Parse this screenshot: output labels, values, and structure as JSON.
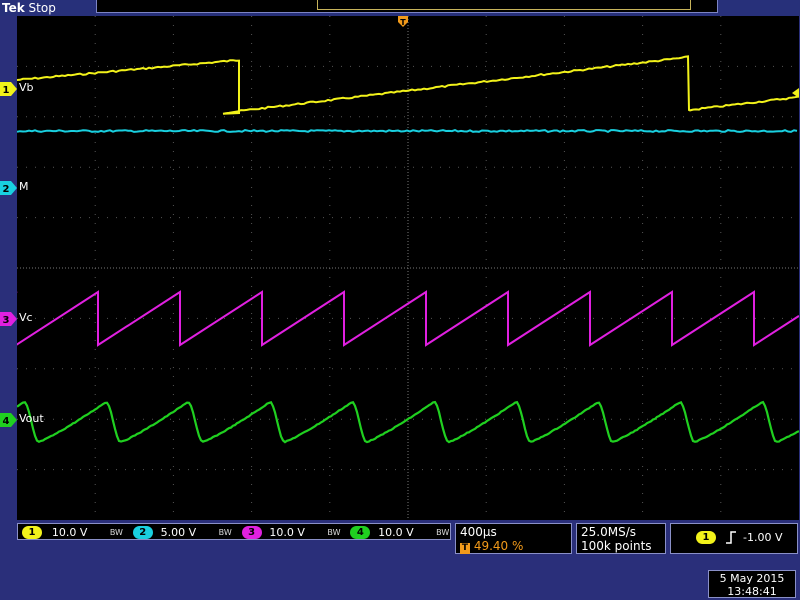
{
  "header": {
    "brand": "Tek",
    "run_state": "Stop",
    "trigger_position_letter": "T"
  },
  "channels": [
    {
      "num": "1",
      "label": "Vb",
      "color": "#f2f21a",
      "scale": "10.0 V"
    },
    {
      "num": "2",
      "label": "M",
      "color": "#19d0e0",
      "scale": "5.00 V"
    },
    {
      "num": "3",
      "label": "Vc",
      "color": "#e020e0",
      "scale": "10.0 V"
    },
    {
      "num": "4",
      "label": "Vout",
      "color": "#20d020",
      "scale": "10.0 V"
    }
  ],
  "bw_limit": "BW",
  "timebase": {
    "time_per_div": "400µs",
    "trigger_pos_badge": "T",
    "trigger_pos": "49.40 %"
  },
  "acquisition": {
    "sample_rate": "25.0MS/s",
    "record_length": "100k points"
  },
  "trigger": {
    "source": "1",
    "slope_icon": "rising-edge-icon",
    "level": "-1.00 V"
  },
  "datetime": {
    "date": "5 May 2015",
    "time": "13:48:41"
  }
}
